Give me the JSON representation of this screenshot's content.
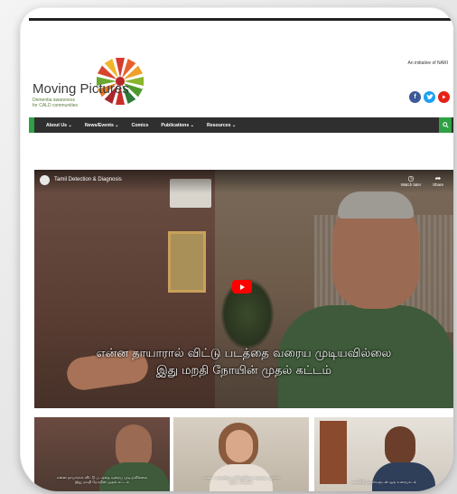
{
  "site": {
    "logo_title": "Moving Pictures",
    "logo_tagline_1": "Dementia awareness",
    "logo_tagline_2": "for CALD communities",
    "initiative": "An initiative of NARI",
    "social_icons": [
      "facebook-icon",
      "twitter-icon",
      "youtube-icon"
    ]
  },
  "nav": {
    "items": [
      {
        "label": "About Us ⌄"
      },
      {
        "label": "News/Events ⌄"
      },
      {
        "label": "Comics"
      },
      {
        "label": "Publications ⌄"
      },
      {
        "label": "Resources ⌄"
      }
    ],
    "search_icon": "search-icon"
  },
  "video": {
    "title": "Tamil Detection & Diagnosis",
    "watch_later": "Watch later",
    "share": "Share",
    "subtitle_line1": "என்ன தாயாரால் விட்டு படத்தை வரைய முடியவில்லை",
    "subtitle_line2": "இது மறதி நோயின் முதல் கட்டம்"
  },
  "thumbnails": [
    {
      "caption_1": "என்ன தாயாரால் விட்டு படத்தை வரைய முடியவில்லை",
      "caption_2": "இது மறதி நோயின் முதல் கட்டம்"
    },
    {
      "caption_1": "டாக்டர் அவனது மறதி குறித்து கூறுவது ஆறாம்",
      "caption_2": "இடைவேளை"
    },
    {
      "caption_1": "கலாநிதி அவர்களுடன் ஒரு உரையாடல்",
      "caption_2": ""
    }
  ],
  "colors": {
    "nav_bg": "#2f2f2f",
    "accent_green": "#2fa043",
    "facebook": "#3b5998",
    "twitter": "#1da1f2",
    "youtube": "#e62117",
    "play_red": "#ff0000"
  }
}
